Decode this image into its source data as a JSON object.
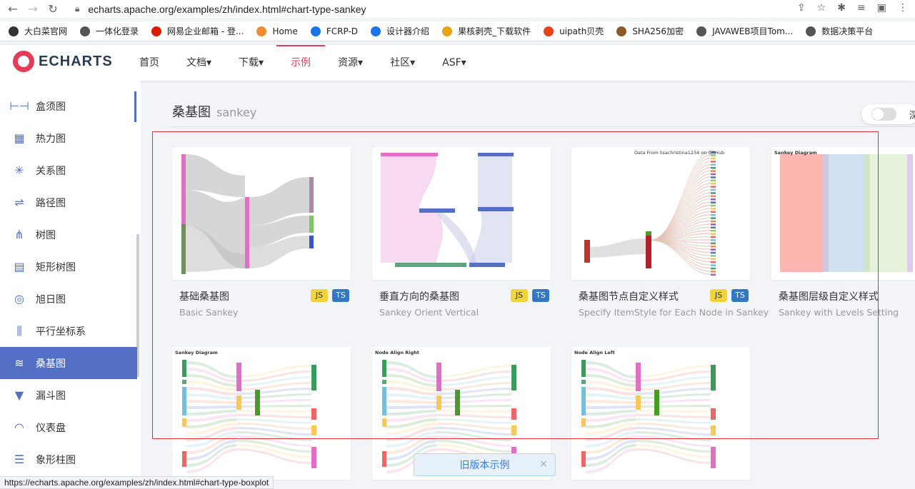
{
  "browser": {
    "url": "echarts.apache.org/examples/zh/index.html#chart-type-sankey",
    "status_url": "https://echarts.apache.org/examples/zh/index.html#chart-type-boxplot",
    "bookmarks": [
      {
        "label": "大白菜官网",
        "color": "#333"
      },
      {
        "label": "一体化登录",
        "color": "#555"
      },
      {
        "label": "网易企业邮箱 - 登...",
        "color": "#d81e06"
      },
      {
        "label": "Home",
        "color": "#f28b30"
      },
      {
        "label": "FCRP-D",
        "color": "#1a73e8"
      },
      {
        "label": "设计器介绍",
        "color": "#1a73e8"
      },
      {
        "label": "果核剥壳_下载软件",
        "color": "#e8a317"
      },
      {
        "label": "uipath贝壳",
        "color": "#e8421a"
      },
      {
        "label": "SHA256加密",
        "color": "#8b5a2b"
      },
      {
        "label": "JAVAWEB项目Tom...",
        "color": "#555"
      },
      {
        "label": "数据决策平台",
        "color": "#555"
      }
    ]
  },
  "header": {
    "logo_text": "ECHARTS",
    "menu": [
      {
        "label": "首页",
        "active": false
      },
      {
        "label": "文档▾",
        "active": false
      },
      {
        "label": "下载▾",
        "active": false
      },
      {
        "label": "示例",
        "active": true
      },
      {
        "label": "资源▾",
        "active": false
      },
      {
        "label": "社区▾",
        "active": false
      },
      {
        "label": "ASF▾",
        "active": false
      }
    ]
  },
  "sidebar": {
    "items": [
      {
        "label": "盒须图",
        "icon": "boxplot-icon",
        "glyph": "⊢⊣"
      },
      {
        "label": "热力图",
        "icon": "heatmap-icon",
        "glyph": "▦"
      },
      {
        "label": "关系图",
        "icon": "graph-icon",
        "glyph": "✳"
      },
      {
        "label": "路径图",
        "icon": "lines-icon",
        "glyph": "⇌"
      },
      {
        "label": "树图",
        "icon": "tree-icon",
        "glyph": "⋔"
      },
      {
        "label": "矩形树图",
        "icon": "treemap-icon",
        "glyph": "▤"
      },
      {
        "label": "旭日图",
        "icon": "sunburst-icon",
        "glyph": "◎"
      },
      {
        "label": "平行坐标系",
        "icon": "parallel-icon",
        "glyph": "⫼"
      },
      {
        "label": "桑基图",
        "icon": "sankey-icon",
        "glyph": "≋"
      },
      {
        "label": "漏斗图",
        "icon": "funnel-icon",
        "glyph": "▼"
      },
      {
        "label": "仪表盘",
        "icon": "gauge-icon",
        "glyph": "◠"
      },
      {
        "label": "象形柱图",
        "icon": "pictorialbar-icon",
        "glyph": "☰"
      }
    ]
  },
  "main": {
    "section_title": "桑基图",
    "section_title_en": "sankey",
    "toggle_label": "深",
    "cards": [
      {
        "title": "基础桑基图",
        "subtitle": "Basic Sankey",
        "thumb_title": ""
      },
      {
        "title": "垂直方向的桑基图",
        "subtitle": "Sankey Orient Vertical",
        "thumb_title": ""
      },
      {
        "title": "桑基图节点自定义样式",
        "subtitle": "Specify ItemStyle for Each Node in Sankey",
        "thumb_title": "Data From lisachristina1234 on GitHub"
      },
      {
        "title": "桑基图层级自定义样式",
        "subtitle": "Sankey with Levels Setting",
        "thumb_title": "Sankey Diagram"
      },
      {
        "title": "",
        "subtitle": "",
        "thumb_title": "Sankey Diagram"
      },
      {
        "title": "",
        "subtitle": "",
        "thumb_title": "Node Align Right"
      },
      {
        "title": "",
        "subtitle": "",
        "thumb_title": "Node Align Left"
      }
    ],
    "badge_js": "JS",
    "badge_ts": "TS",
    "old_examples": "旧版本示例",
    "close_glyph": "×"
  }
}
